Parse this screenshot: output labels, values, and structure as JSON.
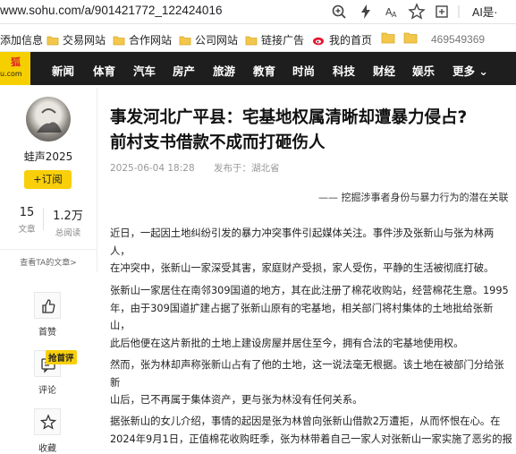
{
  "browser": {
    "url_prefix": "www.sohu.com",
    "url_path": "/a/901421772_122424016",
    "ai_label": "AI是·"
  },
  "bookmarks": {
    "items": [
      "添加信息",
      "交易网站",
      "合作网站",
      "公司网站",
      "链接广告",
      "我的首页"
    ],
    "number": "469549369"
  },
  "nav": {
    "logo_top": "狐",
    "logo_bottom": "u.com",
    "items": [
      "新闻",
      "体育",
      "汽车",
      "房产",
      "旅游",
      "教育",
      "时尚",
      "科技",
      "财经",
      "娱乐",
      "更多 ⌄"
    ]
  },
  "author": {
    "name": "蛙声2025",
    "subscribe": "+订阅",
    "articles_count": "15",
    "articles_label": "文章",
    "views_count": "1.2万",
    "views_label": "总阅读",
    "more_link": "查看TA的文章>"
  },
  "actions": {
    "like": "首赞",
    "comment": "评论",
    "comment_badge": "抢首评",
    "collect": "收藏"
  },
  "article": {
    "title_line1": "事发河北广平县：宅基地权属清晰却遭暴力侵占?",
    "title_line2": "前村支书借款不成而打砸伤人",
    "date": "2025-06-04 18:28",
    "source": "发布于：湖北省",
    "subtitle": "—— 挖掘涉事者身份与暴力行为的潜在关联",
    "paragraphs": [
      [
        "近日，一起因土地纠纷引发的暴力冲突事件引起媒体关注。事件涉及张新山与张为林两人，",
        "在冲突中，张新山一家深受其害，家庭财产受损，家人受伤，平静的生活被彻底打破。"
      ],
      [
        "张新山一家居住在南邻309国道的地方，其在此注册了棉花收购站，经营棉花生意。1995",
        "年，由于309国道扩建占据了张新山原有的宅基地，相关部门将村集体的土地批给张新山，",
        "此后他便在这片新批的土地上建设房屋并居住至今，拥有合法的宅基地使用权。"
      ],
      [
        "然而，张为林却声称张新山占有了他的土地，这一说法毫无根据。该土地在被部门分给张新",
        "山后，已不再属于集体资产，更与张为林没有任何关系。"
      ],
      [
        "据张新山的女儿介绍，事情的起因是张为林曾向张新山借款2万遭拒，从而怀恨在心。在",
        "2024年9月1日，正值棉花收购旺季，张为林带着自己一家人对张新山一家实施了恶劣的报"
      ]
    ]
  },
  "colors": {
    "accent": "#f8cf0a",
    "nav_bg": "#1e1e1e"
  }
}
